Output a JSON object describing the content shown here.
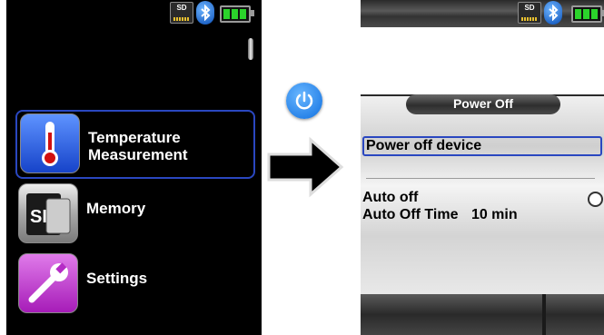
{
  "left_screen": {
    "status": {
      "sd_label": "SD"
    },
    "menu": [
      {
        "label": "Temperature\nMeasurement",
        "icon": "thermometer-icon",
        "selected": true
      },
      {
        "label": "Memory",
        "icon": "sd-card-icon",
        "icon_text": "SD",
        "selected": false
      },
      {
        "label": "Settings",
        "icon": "wrench-icon",
        "selected": false
      }
    ]
  },
  "transition": {
    "icon": "power-icon",
    "arrow": "right-arrow-icon"
  },
  "right_screen": {
    "status": {
      "sd_label": "SD"
    },
    "header": {
      "title": "Power Off"
    },
    "items": [
      {
        "label": "Power off device",
        "selected": true
      },
      {
        "label": "Auto off",
        "control": "radio-unchecked"
      },
      {
        "label": "Auto Off Time",
        "value": "10 min"
      }
    ]
  },
  "colors": {
    "selection": "#2a47c0",
    "battery": "#2bd32b",
    "power_button": "#1577e6"
  }
}
